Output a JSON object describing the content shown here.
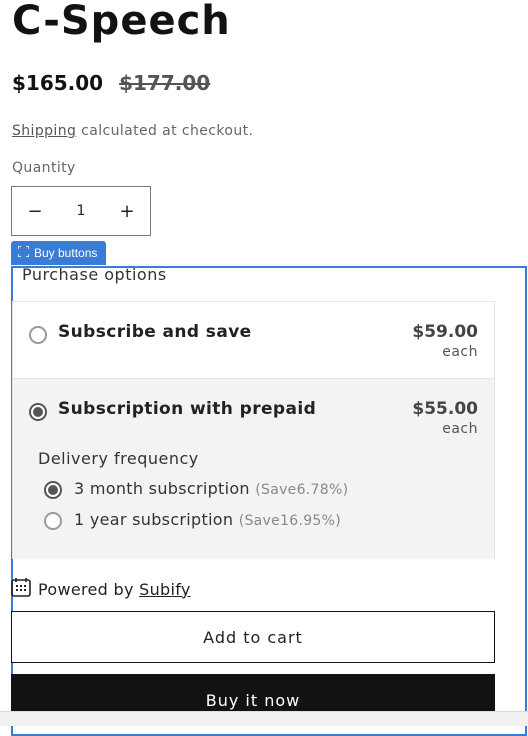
{
  "product": {
    "title": "C-Speech",
    "price": "$165.00",
    "compare_price": "$177.00",
    "shipping_link": "Shipping",
    "shipping_text": " calculated at checkout."
  },
  "quantity": {
    "label": "Quantity",
    "value": "1",
    "minus": "−",
    "plus": "+"
  },
  "buy_buttons_tag": "Buy buttons",
  "purchase": {
    "title": "Purchase options",
    "options": [
      {
        "label": "Subscribe and save",
        "price": "$59.00",
        "unit": "each",
        "selected": false
      },
      {
        "label": "Subscription with prepaid",
        "price": "$55.00",
        "unit": "each",
        "selected": true
      }
    ],
    "frequency": {
      "title": "Delivery frequency",
      "items": [
        {
          "label": "3 month subscription",
          "save": "(Save6.78%)",
          "selected": true
        },
        {
          "label": "1 year subscription",
          "save": "(Save16.95%)",
          "selected": false
        }
      ]
    }
  },
  "powered": {
    "prefix": "Powered by ",
    "brand": "Subify"
  },
  "buttons": {
    "add_to_cart": "Add to cart",
    "buy_now": "Buy it now"
  }
}
